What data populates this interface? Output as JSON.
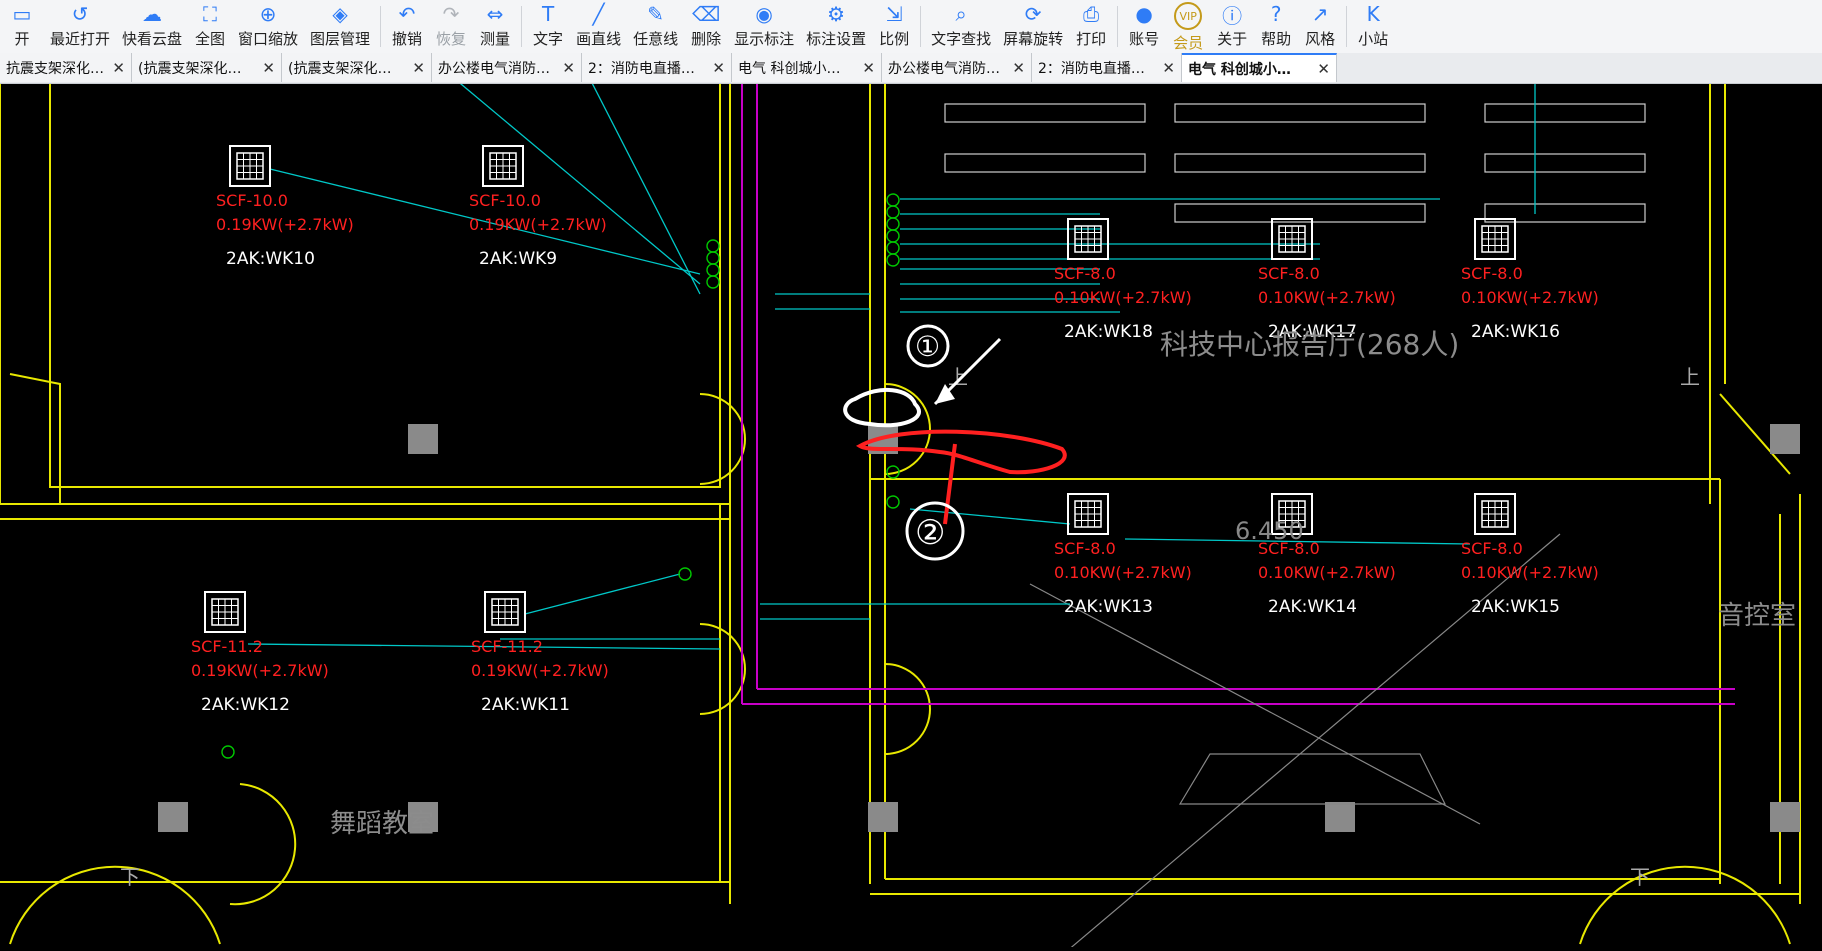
{
  "toolbar": {
    "buttons": [
      {
        "label": "开",
        "icon": "open-icon",
        "disabled": false
      },
      {
        "label": "最近打开",
        "icon": "history-icon",
        "disabled": false
      },
      {
        "label": "快看云盘",
        "icon": "cloud-icon",
        "disabled": false
      },
      {
        "label": "全图",
        "icon": "fit-all-icon",
        "disabled": false
      },
      {
        "label": "窗口缩放",
        "icon": "window-zoom-icon",
        "disabled": false
      },
      {
        "label": "图层管理",
        "icon": "layers-icon",
        "disabled": false
      },
      {
        "label": "撤销",
        "icon": "undo-icon",
        "disabled": false
      },
      {
        "label": "恢复",
        "icon": "redo-icon",
        "disabled": true
      },
      {
        "label": "测量",
        "icon": "measure-icon",
        "disabled": false
      },
      {
        "label": "文字",
        "icon": "text-icon",
        "disabled": false
      },
      {
        "label": "画直线",
        "icon": "line-icon",
        "disabled": false
      },
      {
        "label": "任意线",
        "icon": "pen-icon",
        "disabled": false
      },
      {
        "label": "删除",
        "icon": "eraser-icon",
        "disabled": false
      },
      {
        "label": "显示标注",
        "icon": "eye-icon",
        "disabled": false
      },
      {
        "label": "标注设置",
        "icon": "annotation-settings-icon",
        "disabled": false
      },
      {
        "label": "比例",
        "icon": "scale-icon",
        "disabled": false
      },
      {
        "label": "文字查找",
        "icon": "text-search-icon",
        "disabled": false
      },
      {
        "label": "屏幕旋转",
        "icon": "rotate-screen-icon",
        "disabled": false
      },
      {
        "label": "打印",
        "icon": "print-icon",
        "disabled": false
      },
      {
        "label": "账号",
        "icon": "user-icon",
        "disabled": false
      },
      {
        "label": "会员",
        "icon": "vip-icon",
        "disabled": false
      },
      {
        "label": "关于",
        "icon": "info-icon",
        "disabled": false
      },
      {
        "label": "帮助",
        "icon": "help-icon",
        "disabled": false
      },
      {
        "label": "风格",
        "icon": "style-icon",
        "disabled": false
      },
      {
        "label": "小站",
        "icon": "k-icon",
        "disabled": false
      }
    ],
    "vip_badge": "VIP"
  },
  "tabs": [
    {
      "label": "抗震支架深化…",
      "active": false
    },
    {
      "label": "(抗震支架深化…",
      "active": false
    },
    {
      "label": "(抗震支架深化…",
      "active": false
    },
    {
      "label": "办公楼电气消防…",
      "active": false
    },
    {
      "label": "2：消防电直播…",
      "active": false
    },
    {
      "label": "电气 科创城小…",
      "active": false
    },
    {
      "label": "办公楼电气消防…",
      "active": false
    },
    {
      "label": "2：消防电直播…",
      "active": false
    },
    {
      "label": "电气 科创城小…",
      "active": true
    }
  ],
  "drawing": {
    "units": [
      {
        "spec": "SCF-10.0",
        "power": "0.19KW(+2.7kW)",
        "tag": "2AK:WK10"
      },
      {
        "spec": "SCF-10.0",
        "power": "0.19KW(+2.7kW)",
        "tag": "2AK:WK9"
      },
      {
        "spec": "SCF-8.0",
        "power": "0.10KW(+2.7kW)",
        "tag": "2AK:WK18"
      },
      {
        "spec": "SCF-8.0",
        "power": "0.10KW(+2.7kW)",
        "tag": "2AK:WK17"
      },
      {
        "spec": "SCF-8.0",
        "power": "0.10KW(+2.7kW)",
        "tag": "2AK:WK16"
      },
      {
        "spec": "SCF-11.2",
        "power": "0.19KW(+2.7kW)",
        "tag": "2AK:WK12"
      },
      {
        "spec": "SCF-11.2",
        "power": "0.19KW(+2.7kW)",
        "tag": "2AK:WK11"
      },
      {
        "spec": "SCF-8.0",
        "power": "0.10KW(+2.7kW)",
        "tag": "2AK:WK13"
      },
      {
        "spec": "SCF-8.0",
        "power": "0.10KW(+2.7kW)",
        "tag": "2AK:WK14"
      },
      {
        "spec": "SCF-8.0",
        "power": "0.10KW(+2.7kW)",
        "tag": "2AK:WK15"
      }
    ],
    "room_labels": {
      "room_center": "科技中心报告厅(268人)",
      "dance": "舞蹈教室",
      "control": "音控室"
    },
    "marks": {
      "one": "①",
      "two": "②",
      "up_left": "上",
      "up_right": "上",
      "down_left": "下",
      "down_right": "下",
      "elev": "6.450"
    },
    "colors": {
      "cyan": "#00c8c8",
      "yellow": "#e8e800",
      "red": "#ff2020",
      "magenta": "#c800c8",
      "green": "#00c800"
    }
  }
}
